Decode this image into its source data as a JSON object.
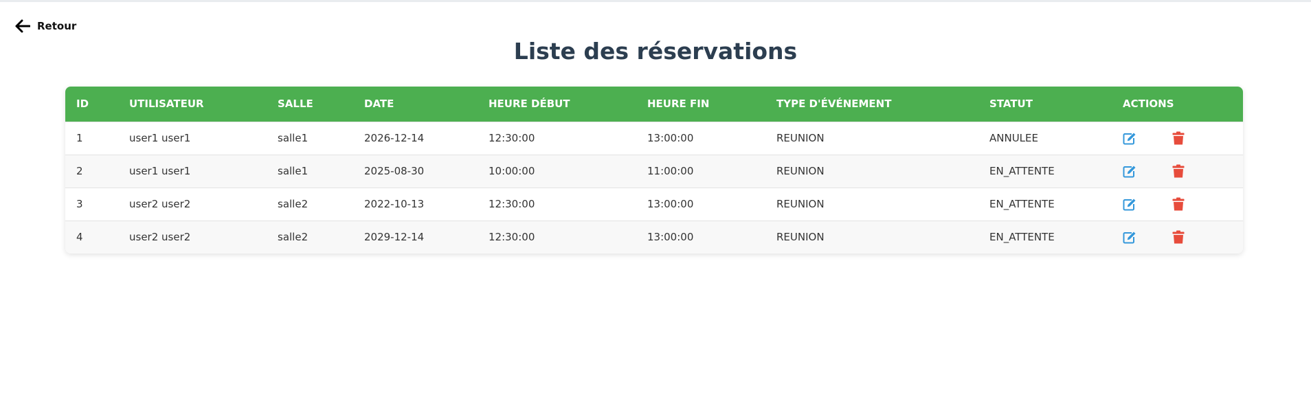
{
  "back": {
    "label": "Retour"
  },
  "page": {
    "title": "Liste des réservations"
  },
  "table": {
    "headers": [
      "ID",
      "UTILISATEUR",
      "SALLE",
      "DATE",
      "HEURE DÉBUT",
      "HEURE FIN",
      "TYPE D'ÉVÉNEMENT",
      "STATUT",
      "ACTIONS"
    ],
    "rows": [
      {
        "id": "1",
        "user": "user1 user1",
        "salle": "salle1",
        "date": "2026-12-14",
        "debut": "12:30:00",
        "fin": "13:00:00",
        "type": "REUNION",
        "statut": "ANNULEE"
      },
      {
        "id": "2",
        "user": "user1 user1",
        "salle": "salle1",
        "date": "2025-08-30",
        "debut": "10:00:00",
        "fin": "11:00:00",
        "type": "REUNION",
        "statut": "EN_ATTENTE"
      },
      {
        "id": "3",
        "user": "user2 user2",
        "salle": "salle2",
        "date": "2022-10-13",
        "debut": "12:30:00",
        "fin": "13:00:00",
        "type": "REUNION",
        "statut": "EN_ATTENTE"
      },
      {
        "id": "4",
        "user": "user2 user2",
        "salle": "salle2",
        "date": "2029-12-14",
        "debut": "12:30:00",
        "fin": "13:00:00",
        "type": "REUNION",
        "statut": "EN_ATTENTE"
      }
    ]
  },
  "icons": {
    "back": "arrow-left-icon",
    "edit": "edit-icon",
    "delete": "trash-icon"
  },
  "colors": {
    "header_bg": "#4caf50",
    "title": "#2c3e50",
    "edit": "#3498db",
    "delete": "#e74c3c"
  }
}
